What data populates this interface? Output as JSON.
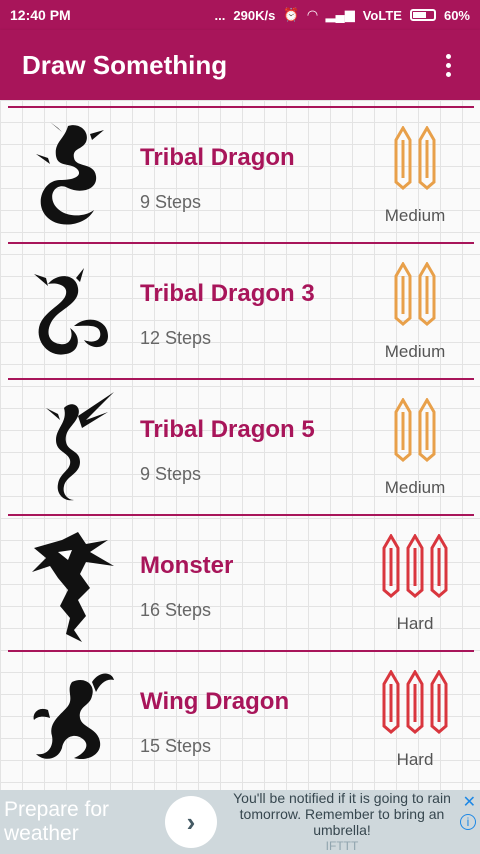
{
  "status": {
    "time": "12:40 PM",
    "dots": "...",
    "speed": "290K/s",
    "network": "VoLTE",
    "battery": "60%"
  },
  "appbar": {
    "title": "Draw Something"
  },
  "items": [
    {
      "name": "Tribal Dragon",
      "steps": "9 Steps",
      "difficulty": "Medium",
      "pencils": 2,
      "pencil_color": "#e8a04a"
    },
    {
      "name": "Tribal Dragon 3",
      "steps": "12 Steps",
      "difficulty": "Medium",
      "pencils": 2,
      "pencil_color": "#e8a04a"
    },
    {
      "name": "Tribal Dragon 5",
      "steps": "9 Steps",
      "difficulty": "Medium",
      "pencils": 2,
      "pencil_color": "#e8a04a"
    },
    {
      "name": "Monster",
      "steps": "16 Steps",
      "difficulty": "Hard",
      "pencils": 3,
      "pencil_color": "#d9363e"
    },
    {
      "name": "Wing Dragon",
      "steps": "15 Steps",
      "difficulty": "Hard",
      "pencils": 3,
      "pencil_color": "#d9363e"
    }
  ],
  "ad": {
    "headline": "Prepare for weather",
    "message": "You'll be notified if it is going to rain tomorrow. Remember to bring an umbrella!",
    "source": "IFTTT",
    "close": "✕",
    "info": "i"
  },
  "colors": {
    "primary": "#a8155a",
    "medium": "#e8a04a",
    "hard": "#d9363e"
  }
}
